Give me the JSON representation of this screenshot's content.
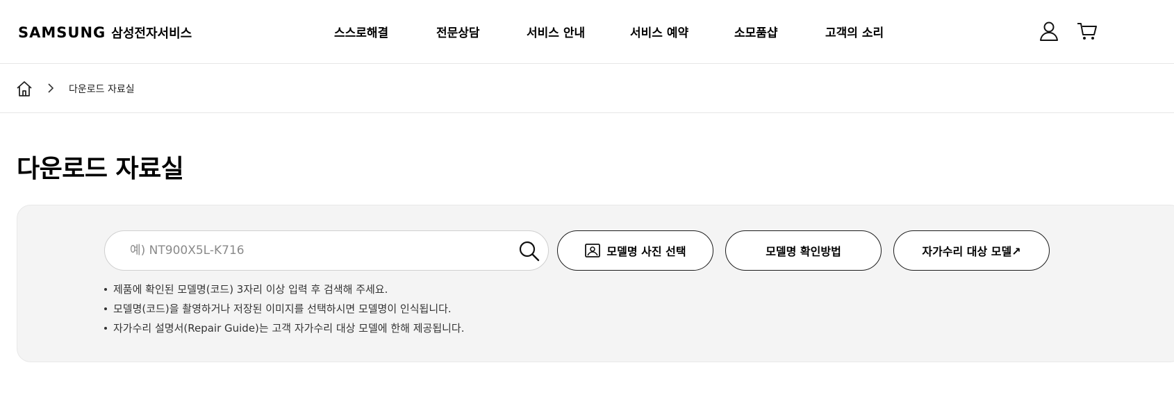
{
  "header": {
    "brand": "SAMSUNG",
    "service_name": "삼성전자서비스",
    "nav": [
      {
        "label": "스스로해결"
      },
      {
        "label": "전문상담"
      },
      {
        "label": "서비스 안내"
      },
      {
        "label": "서비스 예약"
      },
      {
        "label": "소모품샵"
      },
      {
        "label": "고객의 소리"
      }
    ],
    "icons": [
      "user-icon",
      "cart-icon"
    ]
  },
  "breadcrumb": {
    "home_icon": "home-icon",
    "separator_icon": "chevron-right-icon",
    "current": "다운로드 자료실"
  },
  "page": {
    "title": "다운로드 자료실"
  },
  "search": {
    "value": "",
    "placeholder": "예) NT900X5L-K716",
    "button_icon": "search-icon",
    "buttons": [
      {
        "label": "모델명 사진 선택",
        "icon": "image-icon"
      },
      {
        "label": "모델명 확인방법"
      },
      {
        "label": "자가수리 대상 모델↗"
      }
    ],
    "notes": [
      "제품에 확인된 모델명(코드) 3자리 이상 입력 후 검색해 주세요.",
      "모델명(코드)을 촬영하거나 저장된 이미지를 선택하시면 모델명이 인식됩니다.",
      "자가수리 설명서(Repair Guide)는 고객 자가수리 대상 모델에 한해 제공됩니다."
    ]
  },
  "colors": {
    "panel_bg": "#f4f4f4",
    "border": "#e6e6e6",
    "text": "#000000"
  }
}
